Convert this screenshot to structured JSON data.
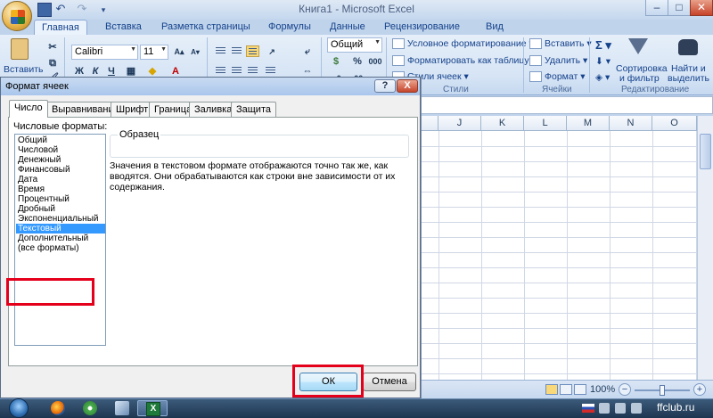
{
  "window": {
    "title": "Книга1 - Microsoft Excel"
  },
  "ribbon_tabs": [
    "Главная",
    "Вставка",
    "Разметка страницы",
    "Формулы",
    "Данные",
    "Рецензирование",
    "Вид"
  ],
  "ribbon": {
    "paste_label": "Вставить",
    "font_name": "Calibri",
    "font_size": "11",
    "bold": "Ж",
    "italic": "К",
    "underline": "Ч",
    "number_format": "Общий",
    "percent": "%",
    "thousands": "000",
    "styles": {
      "conditional": "Условное форматирование",
      "as_table": "Форматировать как таблицу",
      "cell_styles": "Стили ячеек",
      "label": "Стили"
    },
    "cells": {
      "insert": "Вставить",
      "delete": "Удалить",
      "format": "Формат",
      "label": "Ячейки"
    },
    "editing": {
      "sigma": "Σ",
      "sort_line1": "Сортировка",
      "sort_line2": "и фильтр",
      "find_line1": "Найти и",
      "find_line2": "выделить",
      "label": "Редактирование"
    }
  },
  "sheet": {
    "columns": [
      "J",
      "K",
      "L",
      "M",
      "N",
      "O"
    ]
  },
  "statusbar": {
    "zoom": "100%",
    "minus": "−",
    "plus": "+"
  },
  "dialog": {
    "title": "Формат ячеек",
    "help": "?",
    "close": "X",
    "tabs": [
      "Число",
      "Выравнивание",
      "Шрифт",
      "Граница",
      "Заливка",
      "Защита"
    ],
    "active_tab": "Число",
    "formats_label": "Числовые форматы:",
    "formats": [
      "Общий",
      "Числовой",
      "Денежный",
      "Финансовый",
      "Дата",
      "Время",
      "Процентный",
      "Дробный",
      "Экспоненциальный",
      "Текстовый",
      "Дополнительный",
      "(все форматы)"
    ],
    "selected_format": "Текстовый",
    "sample_label": "Образец",
    "description": "Значения в текстовом формате отображаются точно так же, как вводятся. Они обрабатываются как строки вне зависимости от их содержания.",
    "ok": "ОК",
    "cancel": "Отмена"
  },
  "taskbar": {
    "excel_icon": "X"
  },
  "watermark": "ffclub.ru",
  "colors": {
    "highlight_red": "#e4001b",
    "selection_blue": "#3399ff",
    "ribbon_text": "#15428b"
  }
}
